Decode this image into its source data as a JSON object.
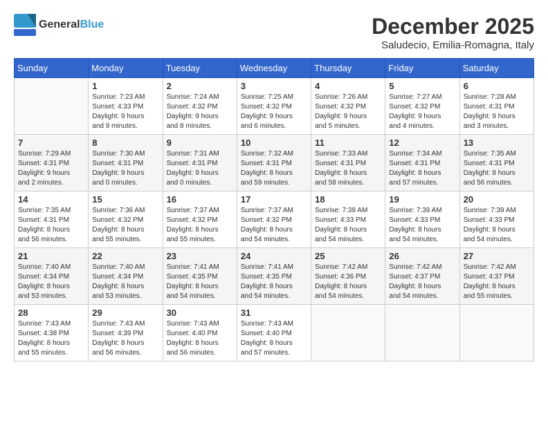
{
  "logo": {
    "general": "General",
    "blue": "Blue"
  },
  "title": "December 2025",
  "subtitle": "Saludecio, Emilia-Romagna, Italy",
  "days_header": [
    "Sunday",
    "Monday",
    "Tuesday",
    "Wednesday",
    "Thursday",
    "Friday",
    "Saturday"
  ],
  "weeks": [
    [
      {
        "day": "",
        "info": ""
      },
      {
        "day": "1",
        "info": "Sunrise: 7:23 AM\nSunset: 4:33 PM\nDaylight: 9 hours\nand 9 minutes."
      },
      {
        "day": "2",
        "info": "Sunrise: 7:24 AM\nSunset: 4:32 PM\nDaylight: 9 hours\nand 8 minutes."
      },
      {
        "day": "3",
        "info": "Sunrise: 7:25 AM\nSunset: 4:32 PM\nDaylight: 9 hours\nand 6 minutes."
      },
      {
        "day": "4",
        "info": "Sunrise: 7:26 AM\nSunset: 4:32 PM\nDaylight: 9 hours\nand 5 minutes."
      },
      {
        "day": "5",
        "info": "Sunrise: 7:27 AM\nSunset: 4:32 PM\nDaylight: 9 hours\nand 4 minutes."
      },
      {
        "day": "6",
        "info": "Sunrise: 7:28 AM\nSunset: 4:31 PM\nDaylight: 9 hours\nand 3 minutes."
      }
    ],
    [
      {
        "day": "7",
        "info": "Sunrise: 7:29 AM\nSunset: 4:31 PM\nDaylight: 9 hours\nand 2 minutes."
      },
      {
        "day": "8",
        "info": "Sunrise: 7:30 AM\nSunset: 4:31 PM\nDaylight: 9 hours\nand 0 minutes."
      },
      {
        "day": "9",
        "info": "Sunrise: 7:31 AM\nSunset: 4:31 PM\nDaylight: 9 hours\nand 0 minutes."
      },
      {
        "day": "10",
        "info": "Sunrise: 7:32 AM\nSunset: 4:31 PM\nDaylight: 8 hours\nand 59 minutes."
      },
      {
        "day": "11",
        "info": "Sunrise: 7:33 AM\nSunset: 4:31 PM\nDaylight: 8 hours\nand 58 minutes."
      },
      {
        "day": "12",
        "info": "Sunrise: 7:34 AM\nSunset: 4:31 PM\nDaylight: 8 hours\nand 57 minutes."
      },
      {
        "day": "13",
        "info": "Sunrise: 7:35 AM\nSunset: 4:31 PM\nDaylight: 8 hours\nand 56 minutes."
      }
    ],
    [
      {
        "day": "14",
        "info": "Sunrise: 7:35 AM\nSunset: 4:31 PM\nDaylight: 8 hours\nand 56 minutes."
      },
      {
        "day": "15",
        "info": "Sunrise: 7:36 AM\nSunset: 4:32 PM\nDaylight: 8 hours\nand 55 minutes."
      },
      {
        "day": "16",
        "info": "Sunrise: 7:37 AM\nSunset: 4:32 PM\nDaylight: 8 hours\nand 55 minutes."
      },
      {
        "day": "17",
        "info": "Sunrise: 7:37 AM\nSunset: 4:32 PM\nDaylight: 8 hours\nand 54 minutes."
      },
      {
        "day": "18",
        "info": "Sunrise: 7:38 AM\nSunset: 4:33 PM\nDaylight: 8 hours\nand 54 minutes."
      },
      {
        "day": "19",
        "info": "Sunrise: 7:39 AM\nSunset: 4:33 PM\nDaylight: 8 hours\nand 54 minutes."
      },
      {
        "day": "20",
        "info": "Sunrise: 7:39 AM\nSunset: 4:33 PM\nDaylight: 8 hours\nand 54 minutes."
      }
    ],
    [
      {
        "day": "21",
        "info": "Sunrise: 7:40 AM\nSunset: 4:34 PM\nDaylight: 8 hours\nand 53 minutes."
      },
      {
        "day": "22",
        "info": "Sunrise: 7:40 AM\nSunset: 4:34 PM\nDaylight: 8 hours\nand 53 minutes."
      },
      {
        "day": "23",
        "info": "Sunrise: 7:41 AM\nSunset: 4:35 PM\nDaylight: 8 hours\nand 54 minutes."
      },
      {
        "day": "24",
        "info": "Sunrise: 7:41 AM\nSunset: 4:35 PM\nDaylight: 8 hours\nand 54 minutes."
      },
      {
        "day": "25",
        "info": "Sunrise: 7:42 AM\nSunset: 4:36 PM\nDaylight: 8 hours\nand 54 minutes."
      },
      {
        "day": "26",
        "info": "Sunrise: 7:42 AM\nSunset: 4:37 PM\nDaylight: 8 hours\nand 54 minutes."
      },
      {
        "day": "27",
        "info": "Sunrise: 7:42 AM\nSunset: 4:37 PM\nDaylight: 8 hours\nand 55 minutes."
      }
    ],
    [
      {
        "day": "28",
        "info": "Sunrise: 7:43 AM\nSunset: 4:38 PM\nDaylight: 8 hours\nand 55 minutes."
      },
      {
        "day": "29",
        "info": "Sunrise: 7:43 AM\nSunset: 4:39 PM\nDaylight: 8 hours\nand 56 minutes."
      },
      {
        "day": "30",
        "info": "Sunrise: 7:43 AM\nSunset: 4:40 PM\nDaylight: 8 hours\nand 56 minutes."
      },
      {
        "day": "31",
        "info": "Sunrise: 7:43 AM\nSunset: 4:40 PM\nDaylight: 8 hours\nand 57 minutes."
      },
      {
        "day": "",
        "info": ""
      },
      {
        "day": "",
        "info": ""
      },
      {
        "day": "",
        "info": ""
      }
    ]
  ]
}
